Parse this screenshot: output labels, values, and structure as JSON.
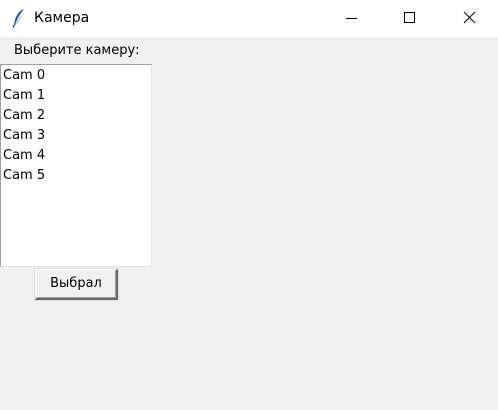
{
  "window": {
    "title": "Камера",
    "icon": "feather-icon",
    "controls": [
      "minimize-icon",
      "maximize-icon",
      "close-icon"
    ]
  },
  "prompt_label": "Выберите камеру:",
  "camera_list": {
    "items": [
      "Cam 0",
      "Cam 1",
      "Cam 2",
      "Cam 3",
      "Cam 4",
      "Cam 5"
    ]
  },
  "select_button_label": "Выбрал"
}
